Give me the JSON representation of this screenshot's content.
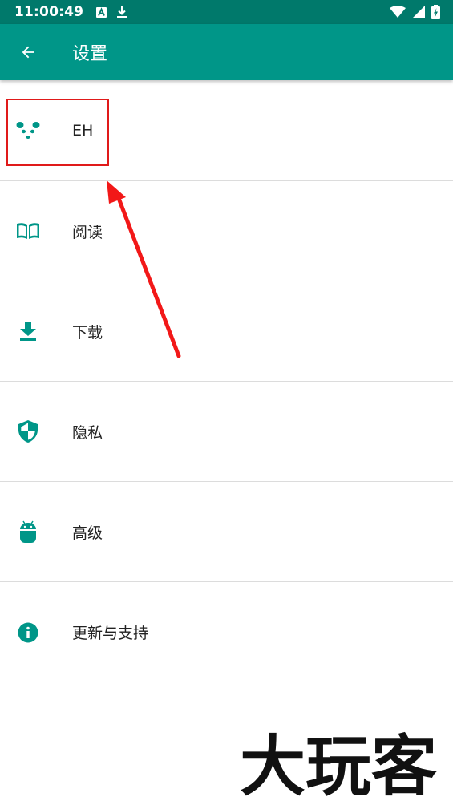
{
  "status_bar": {
    "time": "11:00:49",
    "icons": [
      "notification-a-icon",
      "download-icon",
      "wifi-icon",
      "signal-icon",
      "battery-charging-icon"
    ],
    "color": "#00796b"
  },
  "app_bar": {
    "title": "设置",
    "back_icon": "arrow-back-icon",
    "color": "#009688"
  },
  "settings": {
    "items": [
      {
        "label": "EH",
        "icon": "panda-icon"
      },
      {
        "label": "阅读",
        "icon": "book-icon"
      },
      {
        "label": "下载",
        "icon": "download-icon"
      },
      {
        "label": "隐私",
        "icon": "shield-icon"
      },
      {
        "label": "高级",
        "icon": "android-icon"
      },
      {
        "label": "更新与支持",
        "icon": "info-icon"
      }
    ],
    "icon_color": "#009688"
  },
  "annotation": {
    "highlight_color": "#e01a1a",
    "target": "EH"
  },
  "watermark": {
    "text": "大玩客"
  }
}
